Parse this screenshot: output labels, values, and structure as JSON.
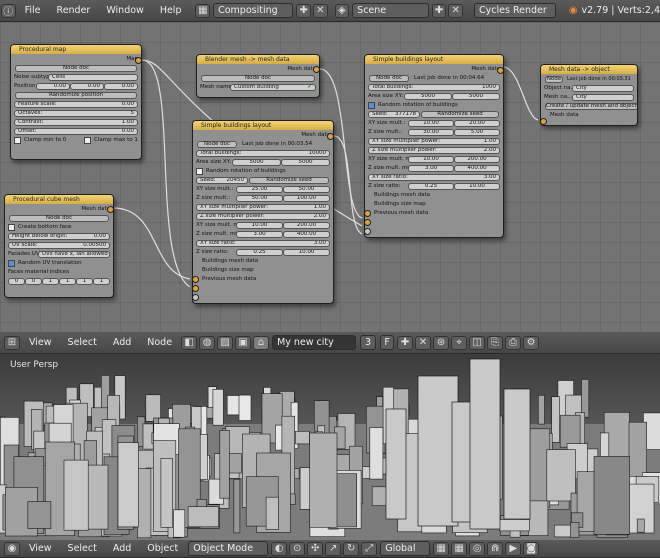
{
  "top_bar": {
    "menus": [
      "File",
      "Render",
      "Window",
      "Help"
    ],
    "screen_layout": "Compositing",
    "scene": "Scene",
    "render_engine": "Cycles Render",
    "version": "v2.79 | Verts:2,4"
  },
  "nodes": {
    "procedural_map": {
      "title": "Procedural map",
      "output": "Map",
      "node_doc": "Node doc",
      "noise_subtype_label": "Noise subtype:",
      "noise_subtype": "Cells",
      "position_label": "Position:",
      "position": [
        "0.00",
        "0.00",
        "0.00"
      ],
      "randomize": "Randomize position",
      "feature_scale_label": "Feature scale:",
      "feature_scale": "0.00",
      "octaves_label": "Octaves:",
      "octaves": "5",
      "contrast_label": "Contrast:",
      "contrast": "1.00",
      "offset_label": "Offset:",
      "offset": "0.00",
      "clamp_min": "Clamp min to 0",
      "clamp_max": "Clamp max to 1"
    },
    "cube_mesh": {
      "title": "Procedural cube mesh",
      "output": "Mesh data",
      "node_doc": "Node doc",
      "create_bottom": "Create bottom face",
      "height_label": "Height below origin:",
      "height": "0.00",
      "uv_scale_label": "UV scale:",
      "uv_scale": "0.00500",
      "facades_label": "Facades UV...",
      "facades": "UVs have x, lan allowed",
      "random_uv": "Random UV translation",
      "faces_label": "Faces material indices",
      "faces": [
        "0",
        "0",
        "1",
        "1",
        "1",
        "1"
      ]
    },
    "blender_mesh": {
      "title": "Blender mesh -> mesh data",
      "output": "Mesh data",
      "node_doc": "Node doc",
      "mesh_name_label": "Mesh name:",
      "mesh_name": "Custom building"
    },
    "layout1": {
      "title": "Simple buildings layout",
      "output": "Mesh data",
      "node_doc": "Node doc",
      "last_job": "Last job done in 00:03.54",
      "total_label": "Total buildings:",
      "total": "10000",
      "area_label": "Area size XY:",
      "area": [
        "5000",
        "5000"
      ],
      "random_rot": "Random rotation of buildings",
      "seed_label": "Seed:",
      "seed": "20450",
      "randomize_seed": "Randomize seed",
      "rows": [
        {
          "label": "XY size mult.:",
          "a": "25.00",
          "b": "50.00"
        },
        {
          "label": "Z size mult.:",
          "a": "50.00",
          "b": "100.00"
        }
      ],
      "xy_power_label": "XY size multiplier power:",
      "xy_power": "1.00",
      "z_power_label": "Z size multiplier power:",
      "z_power": "2.00",
      "rows2": [
        {
          "label": "XY size mult. min:",
          "a": "10.00",
          "b": "200.00"
        },
        {
          "label": "Z size mult. min/...:",
          "a": "3.00",
          "b": "400.00"
        }
      ],
      "xy_ratio_label": "XY size ratio:",
      "xy_ratio": "3.00",
      "z_ratio_label": "Z size ratio:",
      "z_ratio": [
        "0.25",
        "10.00"
      ],
      "inputs": [
        "Buildings mesh data",
        "Buildings size map",
        "Previous mesh data"
      ]
    },
    "layout2": {
      "title": "Simple buildings layout",
      "output": "Mesh data",
      "node_doc": "Node doc",
      "last_job": "Last job done in 00:04.64",
      "total_label": "Total buildings:",
      "total": "1000",
      "area_label": "Area size XY:",
      "area": [
        "5000",
        "5000"
      ],
      "random_rot": "Random rotation of buildings",
      "seed_label": "Seed:",
      "seed": "377178",
      "randomize_seed": "Randomize seed",
      "rows": [
        {
          "label": "XY size mult.:",
          "a": "10.00",
          "b": "20.00"
        },
        {
          "label": "Z size mult.:",
          "a": "30.00",
          "b": "5.00"
        }
      ],
      "xy_power_label": "XY size multiplier power:",
      "xy_power": "1.00",
      "z_power_label": "Z size multiplier power:",
      "z_power": "2.00",
      "rows2": [
        {
          "label": "XY size mult. mi...:",
          "a": "10.00",
          "b": "200.00"
        },
        {
          "label": "Z size mult. min/...:",
          "a": "3.00",
          "b": "400.00"
        }
      ],
      "xy_ratio_label": "XY size ratio:",
      "xy_ratio": "3.00",
      "z_ratio_label": "Z size ratio:",
      "z_ratio": [
        "0.25",
        "10.00"
      ],
      "inputs": [
        "Buildings mesh data",
        "Buildings size map",
        "Previous mesh data"
      ]
    },
    "to_object": {
      "title": "Mesh data -> object",
      "node_doc": "Node",
      "last_job": "Last job done in 00:03.31",
      "object_label": "Object na...",
      "object": "City",
      "mesh_label": "Mesh na...",
      "mesh": "City",
      "update_btn": "Create / update mesh and object",
      "input": "Mesh data"
    }
  },
  "node_bar": {
    "menus": [
      "View",
      "Select",
      "Add",
      "Node"
    ],
    "tree_name": "My new city",
    "users": "3",
    "fake": "F"
  },
  "viewport": {
    "label": "User Persp"
  },
  "view_bar": {
    "menus": [
      "View",
      "Select",
      "Add",
      "Object"
    ],
    "mode": "Object Mode",
    "orientation": "Global"
  },
  "colors": {
    "node_header": "#e6c15a",
    "node_body": "#909090",
    "editor_bg": "#737373",
    "socket": "#e0a040"
  }
}
